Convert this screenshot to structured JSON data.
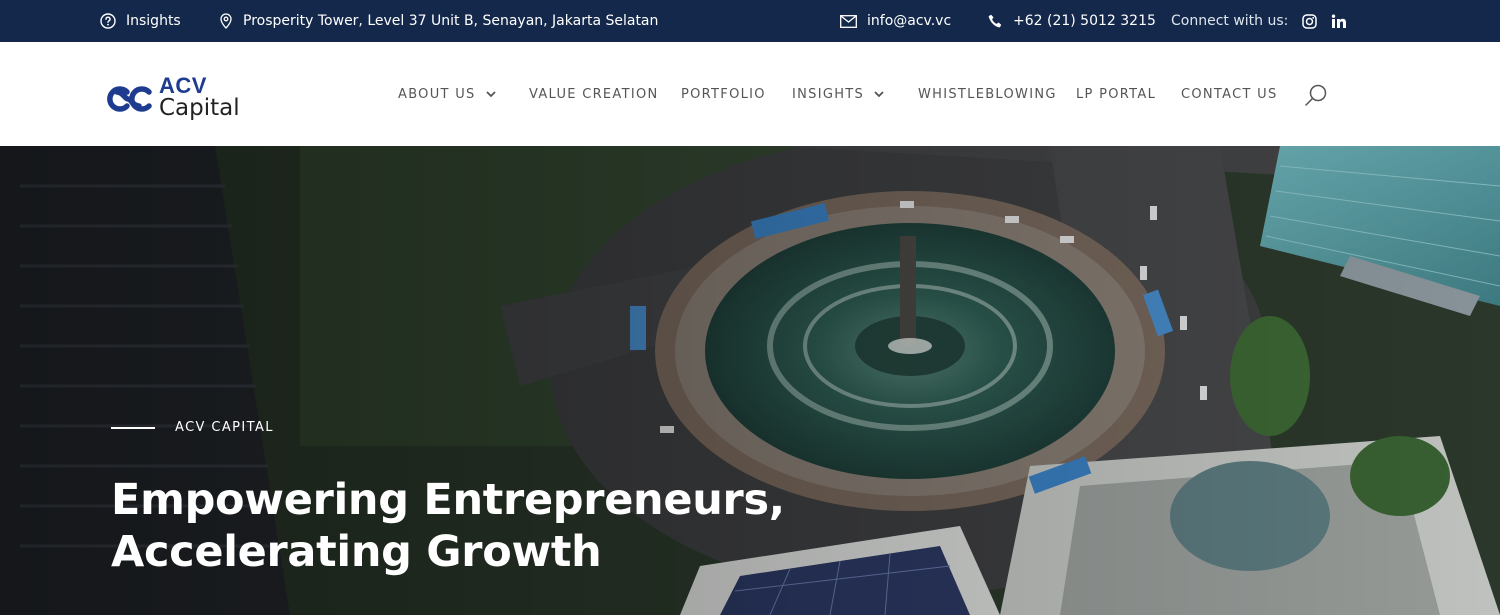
{
  "topbar": {
    "insights_label": "Insights",
    "address": "Prosperity Tower, Level 37 Unit B, Senayan, Jakarta Selatan",
    "email": "info@acv.vc",
    "phone": "+62 (21) 5012 3215",
    "connect_label": "Connect with us:",
    "social_icons": [
      "instagram-icon",
      "linkedin-icon"
    ]
  },
  "brand": {
    "name_top": "ACV",
    "name_bottom": "Capital",
    "color": "#1e3c8f"
  },
  "nav": {
    "items": [
      {
        "label": "ABOUT US",
        "has_dropdown": true
      },
      {
        "label": "VALUE CREATION",
        "has_dropdown": false
      },
      {
        "label": "PORTFOLIO",
        "has_dropdown": false
      },
      {
        "label": "INSIGHTS",
        "has_dropdown": true
      },
      {
        "label": "WHISTLEBLOWING",
        "has_dropdown": false
      },
      {
        "label": "LP PORTAL",
        "has_dropdown": false
      },
      {
        "label": "CONTACT US",
        "has_dropdown": false
      }
    ],
    "search_icon": "search-icon"
  },
  "hero": {
    "eyebrow": "ACV CAPITAL",
    "title_line1": "Empowering Entrepreneurs,",
    "title_line2": "Accelerating Growth"
  },
  "colors": {
    "topbar_bg": "#14284b",
    "header_bg": "#ffffff",
    "nav_text": "#555555"
  }
}
